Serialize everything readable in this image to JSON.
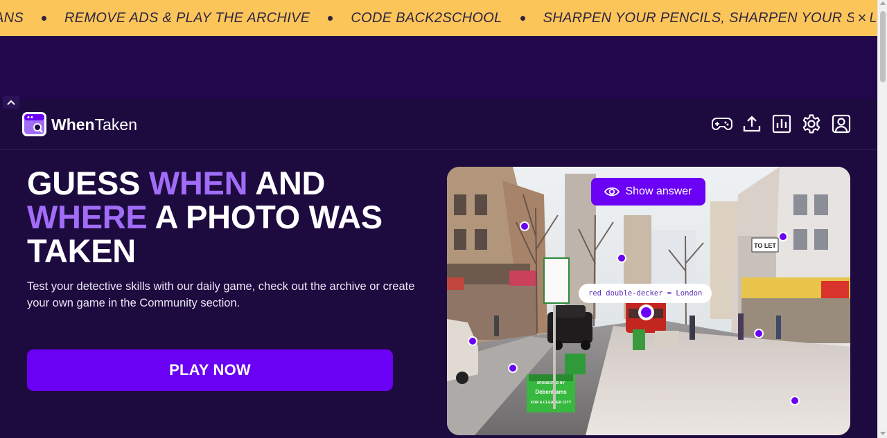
{
  "banner": {
    "items": [
      "ANS",
      "REMOVE ADS & PLAY THE ARCHIVE",
      "CODE BACK2SCHOOL",
      "SHARPEN YOUR PENCILS, SHARPEN YOUR SKILLS"
    ],
    "close_label": "×",
    "background": "#fcc55a"
  },
  "header": {
    "brand_bold": "When",
    "brand_light": "Taken",
    "nav_icons": [
      "gamepad-icon",
      "upload-icon",
      "stats-icon",
      "settings-icon",
      "profile-icon"
    ]
  },
  "hero": {
    "title_line1_a": "GUESS ",
    "title_line1_b": "WHEN",
    "title_line1_c": " AND",
    "title_line2_a": "WHERE",
    "title_line2_b": " A PHOTO WAS",
    "title_line3": "TAKEN",
    "description": "Test your detective skills with our daily game, check out the archive or create your own game in the Community section.",
    "play_label": "PLAY NOW"
  },
  "photo": {
    "show_answer_label": "Show answer",
    "hint_text": "red double-decker = London",
    "sign_to_let": "TO LET",
    "sign_debenhams": "Debenhams",
    "sign_cleaner_city": "FOR A CLEANER CITY",
    "sign_sponsored": "SPONSORED BY"
  },
  "colors": {
    "page_bg": "#1d0a3f",
    "accent_purple": "#a16cf7",
    "primary_button": "#6a00f4"
  }
}
